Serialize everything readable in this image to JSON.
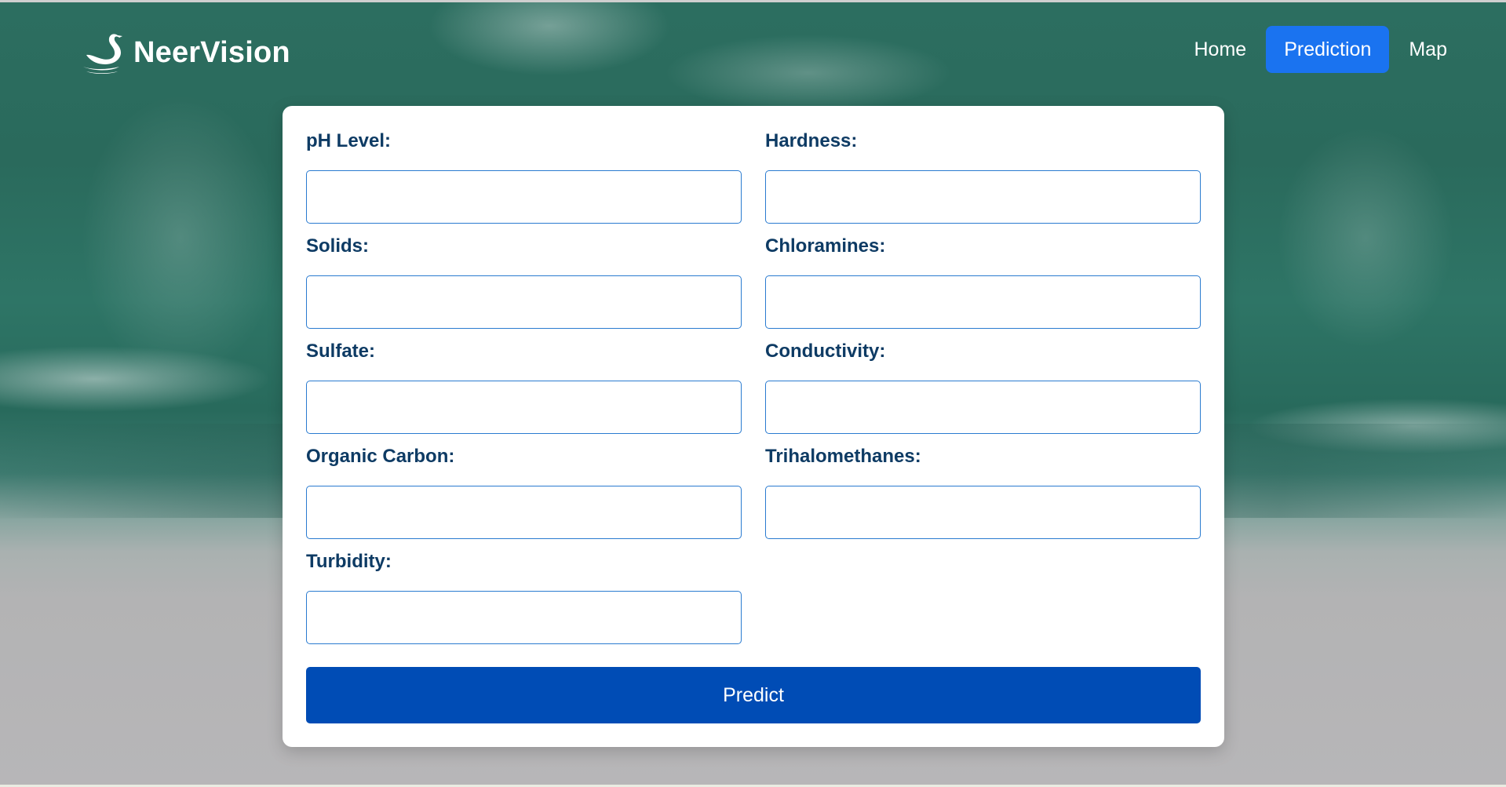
{
  "brand": {
    "name": "NeerVision",
    "logo_icon": "swan-icon"
  },
  "nav": {
    "items": [
      {
        "label": "Home",
        "active": false
      },
      {
        "label": "Prediction",
        "active": true
      },
      {
        "label": "Map",
        "active": false
      }
    ],
    "active_color": "#1a73f0"
  },
  "form": {
    "fields": {
      "ph": {
        "label": "pH Level:",
        "value": ""
      },
      "hardness": {
        "label": "Hardness:",
        "value": ""
      },
      "solids": {
        "label": "Solids:",
        "value": ""
      },
      "chloramines": {
        "label": "Chloramines:",
        "value": ""
      },
      "sulfate": {
        "label": "Sulfate:",
        "value": ""
      },
      "conductivity": {
        "label": "Conductivity:",
        "value": ""
      },
      "organic_carbon": {
        "label": "Organic Carbon:",
        "value": ""
      },
      "trihalomethanes": {
        "label": "Trihalomethanes:",
        "value": ""
      },
      "turbidity": {
        "label": "Turbidity:",
        "value": ""
      }
    },
    "submit_label": "Predict",
    "label_color": "#0e3b64",
    "button_color": "#004cb5"
  }
}
